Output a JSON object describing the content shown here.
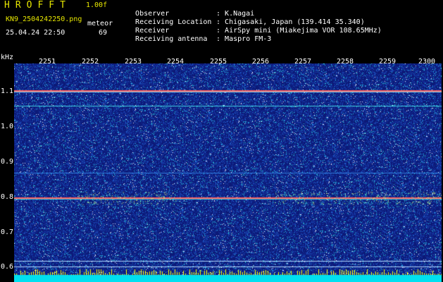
{
  "header": {
    "title": "HROFFT",
    "version": "1.00f",
    "filename": "KN9_2504242250.png",
    "datetime": "25.04.24 22:50",
    "meteor_label": "meteor",
    "meteor_count": "69"
  },
  "info": [
    {
      "key": "Observer",
      "value": "K.Nagai"
    },
    {
      "key": "Receiving Location",
      "value": "Chigasaki, Japan (139.414 35.340)"
    },
    {
      "key": "Receiver",
      "value": "AirSpy mini (Miakejima VOR 108.65MHz)"
    },
    {
      "key": "Receiving antenna",
      "value": "Maspro FM-3"
    }
  ],
  "axis": {
    "unit": "kHz",
    "y_ticks": [
      "1.1",
      "1.0",
      "0.9",
      "0.8",
      "0.7",
      "0.6"
    ],
    "time_ticks": [
      "2251",
      "2252",
      "2253",
      "2254",
      "2255",
      "2256",
      "2257",
      "2258",
      "2259",
      "2300"
    ]
  },
  "colors": {
    "background": "#0c1a78",
    "text_yellow": "#e6e600",
    "signal_line": "#ff6060"
  }
}
